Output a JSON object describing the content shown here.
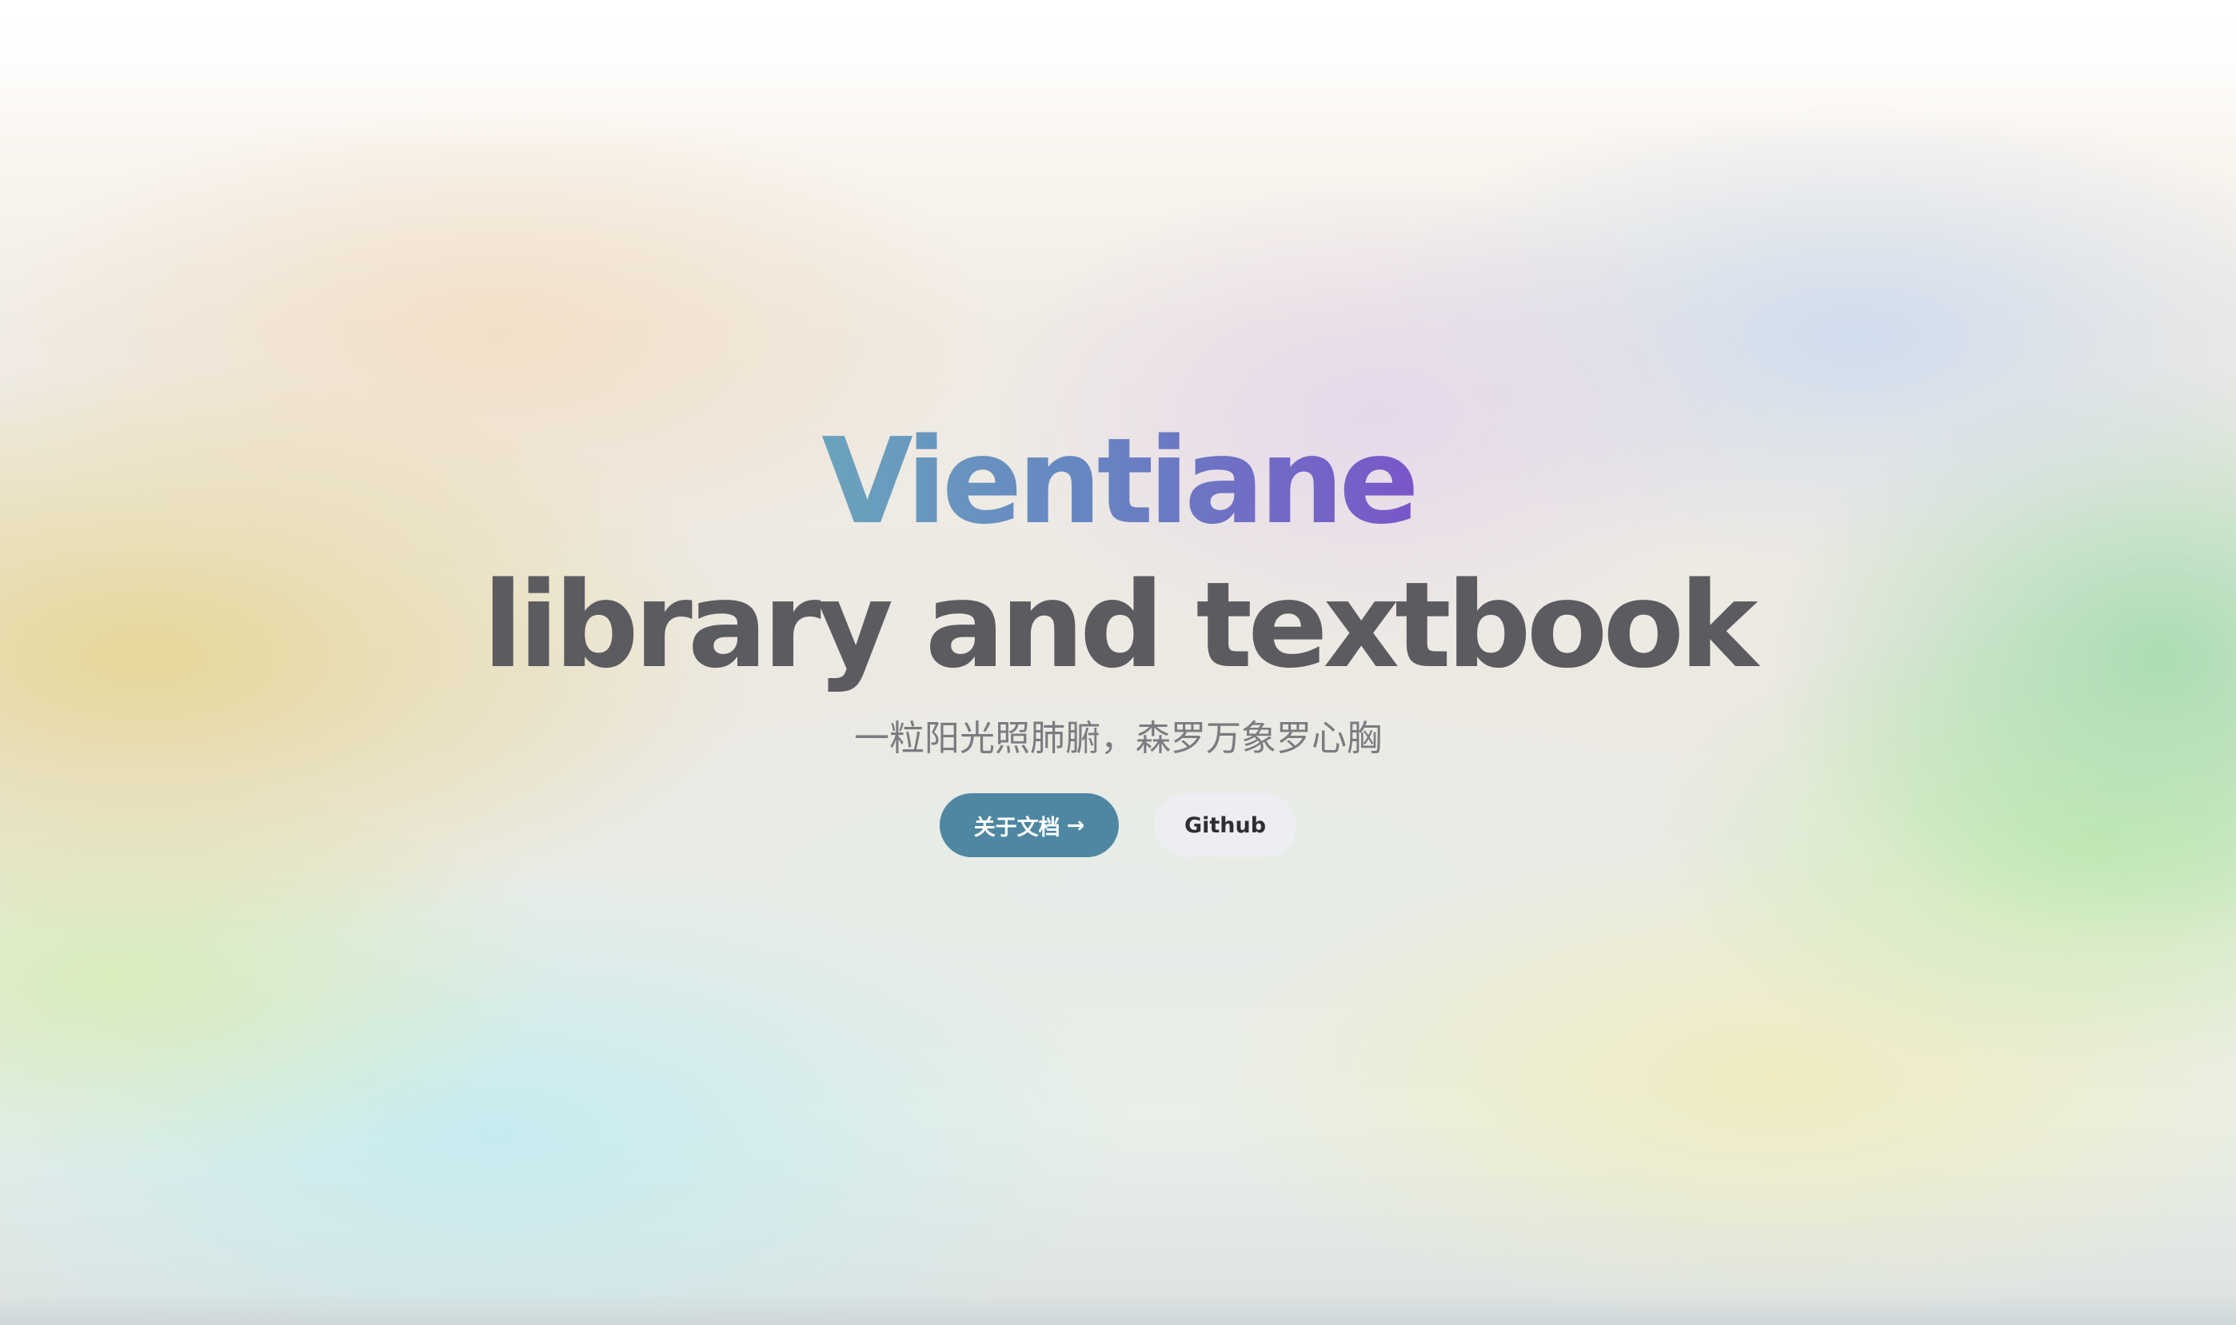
{
  "hero": {
    "brand": "Vientiane",
    "headline": "library and textbook",
    "subtitle": "一粒阳光照肺腑，森罗万象罗心胸"
  },
  "actions": {
    "primary_label": "关于文档",
    "primary_icon": "arrow-right-icon",
    "primary_icon_glyph": "→",
    "secondary_label": "Github"
  },
  "colors": {
    "brand_gradient_start": "#6aa3bc",
    "brand_gradient_mid": "#6685c2",
    "brand_gradient_end": "#7a56c8",
    "headline": "#5c5b60",
    "subtitle": "#7b7b80",
    "primary_button": "#4f87a2",
    "secondary_button": "#eceef2"
  }
}
